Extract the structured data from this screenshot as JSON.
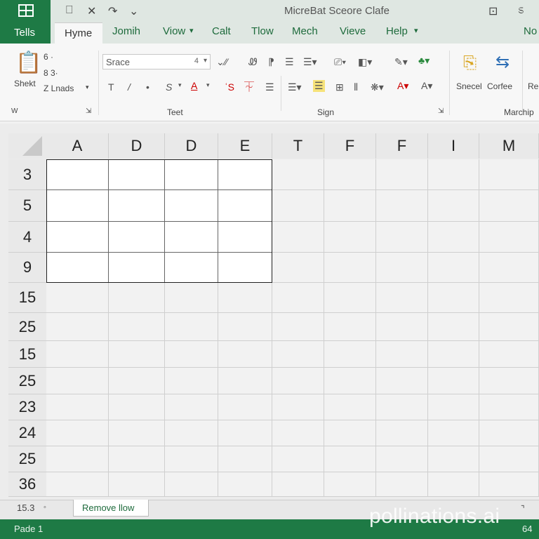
{
  "app": {
    "logo_label": "Tells",
    "window_title": "MicreBat Sceore Clafe",
    "qat_icons": [
      "save-icon",
      "close-x-icon",
      "redo-icon"
    ]
  },
  "tabs": [
    "Hyme",
    "Jomih",
    "Viow",
    "Calt",
    "Tlow",
    "Mech",
    "Vieve",
    "Help",
    "No"
  ],
  "ribbon": {
    "clipboard": {
      "paste_label": "Shekt",
      "item1": "6 ·",
      "item2": "8 3·",
      "item3": "Z Lnads"
    },
    "font_box": {
      "value": "Srace",
      "size": "4"
    },
    "styles": {
      "label1": "Snecel",
      "label2": "Corfee",
      "label3": "Re"
    },
    "groups": {
      "g1": "W",
      "text": "Teet",
      "sign": "Sign",
      "right": "Marchip"
    }
  },
  "grid": {
    "columns": [
      "A",
      "D",
      "D",
      "E",
      "T",
      "F",
      "F",
      "I",
      "M"
    ],
    "rows": [
      "3",
      "5",
      "4",
      "9",
      "15",
      "25",
      "15",
      "25",
      "23",
      "24",
      "25",
      "36"
    ]
  },
  "sheetbar": {
    "name_box": "15.3",
    "sheet_tab": "Remove llow"
  },
  "status": {
    "left": "Pade 1",
    "right": "64"
  },
  "watermark": "pollinations.ai",
  "colors": {
    "accent": "#1e7a45",
    "tab_text": "#1e6b3c"
  }
}
